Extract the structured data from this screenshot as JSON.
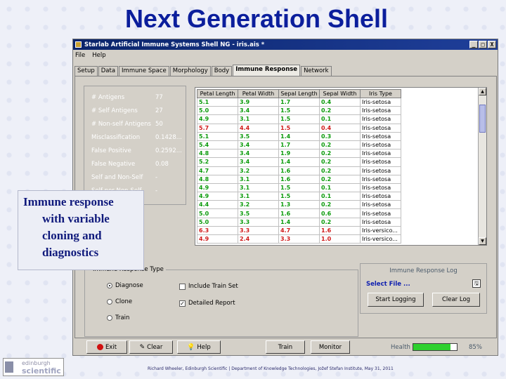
{
  "slide": {
    "title": "Next Generation Shell",
    "callout": [
      "Immune response",
      "with variable",
      "cloning and",
      "diagnostics"
    ],
    "footer": "Richard Wheeler, Edinburgh Scientific  |  Department of Knowledge Technologies, Jožef Stefan Institute, May 31, 2011",
    "logo_top": "edinburgh",
    "logo_bottom": "scientific"
  },
  "window": {
    "title": "Starlab Artificial Immune Systems Shell NG  -  iris.ais *",
    "controls": [
      "_",
      "□",
      "X"
    ]
  },
  "menu": [
    "File",
    "Help"
  ],
  "tabs": [
    {
      "label": "Setup",
      "active": false
    },
    {
      "label": "Data",
      "active": false
    },
    {
      "label": "Immune Space",
      "active": false
    },
    {
      "label": "Morphology",
      "active": false
    },
    {
      "label": "Body",
      "active": false
    },
    {
      "label": "Immune Response",
      "active": true
    },
    {
      "label": "Network",
      "active": false
    }
  ],
  "stats": [
    {
      "label": "# Antigens",
      "value": "77"
    },
    {
      "label": "# Self Antigens",
      "value": "27"
    },
    {
      "label": "# Non-self Antigens",
      "value": "50"
    },
    {
      "label": "Misclassification",
      "value": "0.1428..."
    },
    {
      "label": "False Positive",
      "value": "0.2592..."
    },
    {
      "label": "False Negative",
      "value": "0.08"
    },
    {
      "label": "Self and Non-Self",
      "value": "-"
    },
    {
      "label": "Self nor Non-Self",
      "value": "-"
    }
  ],
  "table": {
    "columns": [
      "Petal Length",
      "Petal Width",
      "Sepal Length",
      "Sepal Width",
      "Iris Type"
    ],
    "rows": [
      {
        "cells": [
          "5.1",
          "3.9",
          "1.7",
          "0.4",
          "Iris-setosa"
        ],
        "color": "#0a9a0a"
      },
      {
        "cells": [
          "5.0",
          "3.4",
          "1.5",
          "0.2",
          "Iris-setosa"
        ],
        "color": "#0a9a0a"
      },
      {
        "cells": [
          "4.9",
          "3.1",
          "1.5",
          "0.1",
          "Iris-setosa"
        ],
        "color": "#0a9a0a"
      },
      {
        "cells": [
          "5.7",
          "4.4",
          "1.5",
          "0.4",
          "Iris-setosa"
        ],
        "color": "#d01818"
      },
      {
        "cells": [
          "5.1",
          "3.5",
          "1.4",
          "0.3",
          "Iris-setosa"
        ],
        "color": "#0a9a0a"
      },
      {
        "cells": [
          "5.4",
          "3.4",
          "1.7",
          "0.2",
          "Iris-setosa"
        ],
        "color": "#0a9a0a"
      },
      {
        "cells": [
          "4.8",
          "3.4",
          "1.9",
          "0.2",
          "Iris-setosa"
        ],
        "color": "#0a9a0a"
      },
      {
        "cells": [
          "5.2",
          "3.4",
          "1.4",
          "0.2",
          "Iris-setosa"
        ],
        "color": "#0a9a0a"
      },
      {
        "cells": [
          "4.7",
          "3.2",
          "1.6",
          "0.2",
          "Iris-setosa"
        ],
        "color": "#0a9a0a"
      },
      {
        "cells": [
          "4.8",
          "3.1",
          "1.6",
          "0.2",
          "Iris-setosa"
        ],
        "color": "#0a9a0a"
      },
      {
        "cells": [
          "4.9",
          "3.1",
          "1.5",
          "0.1",
          "Iris-setosa"
        ],
        "color": "#0a9a0a"
      },
      {
        "cells": [
          "4.9",
          "3.1",
          "1.5",
          "0.1",
          "Iris-setosa"
        ],
        "color": "#0a9a0a"
      },
      {
        "cells": [
          "4.4",
          "3.2",
          "1.3",
          "0.2",
          "Iris-setosa"
        ],
        "color": "#0a9a0a"
      },
      {
        "cells": [
          "5.0",
          "3.5",
          "1.6",
          "0.6",
          "Iris-setosa"
        ],
        "color": "#0a9a0a"
      },
      {
        "cells": [
          "5.0",
          "3.3",
          "1.4",
          "0.2",
          "Iris-setosa"
        ],
        "color": "#0a9a0a"
      },
      {
        "cells": [
          "6.3",
          "3.3",
          "4.7",
          "1.6",
          "Iris-versico..."
        ],
        "color": "#d01818"
      },
      {
        "cells": [
          "4.9",
          "2.4",
          "3.3",
          "1.0",
          "Iris-versico..."
        ],
        "color": "#d01818"
      }
    ]
  },
  "immune_response": {
    "legend": "Immune Response Type",
    "options": [
      {
        "label": "Diagnose",
        "selected": true
      },
      {
        "label": "Clone",
        "selected": false
      },
      {
        "label": "Train",
        "selected": false
      }
    ],
    "checks": [
      {
        "label": "Include Train Set",
        "checked": false
      },
      {
        "label": "Detailed Report",
        "checked": true
      }
    ]
  },
  "log": {
    "legend": "Immune Response Log",
    "select_file": "Select File ...",
    "start_label": "Start Logging",
    "clear_label": "Clear Log"
  },
  "bottom": {
    "exit_label": "Exit",
    "clear_label": "Clear",
    "help_label": "Help",
    "train_label": "Train",
    "monitor_label": "Monitor",
    "health_label": "Health",
    "health_value": "85%",
    "health_fraction": 0.85
  },
  "colors": {
    "title": "#0b1e9c",
    "titlebar": "#0a246a",
    "good_row": "#0a9a0a",
    "bad_row": "#d01818",
    "health": "#2ed02e"
  }
}
